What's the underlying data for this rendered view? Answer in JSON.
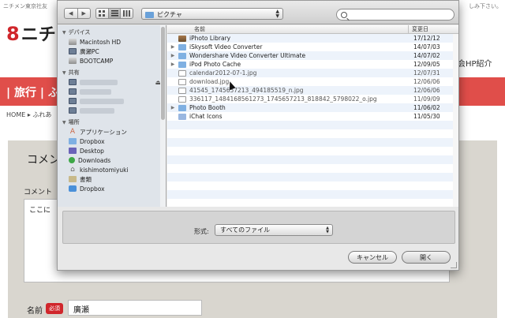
{
  "background": {
    "top_left": "ニチメン東京社友",
    "top_right": "しみ下さい。",
    "logo_text": "ニチ",
    "hp_link": "会HP紹介",
    "nav_text": "| 旅行 | ふ",
    "breadcrumb": "HOME ▸ ふれあ",
    "comment_title": "コメン",
    "comment_label": "コメント",
    "comment_text": "ここに",
    "name_label": "名前",
    "required_badge": "必須",
    "name_value": "廣瀬"
  },
  "dialog": {
    "toolbar": {
      "back": "◀",
      "forward": "▶",
      "location": "ピクチャ",
      "search_value": ""
    },
    "sidebar": {
      "devices_header": "デバイス",
      "devices": [
        {
          "label": "Macintosh HD",
          "icon": "hard-drive-icon"
        },
        {
          "label": "廣瀬PC",
          "icon": "pc-icon"
        },
        {
          "label": "BOOTCAMP",
          "icon": "hard-drive-icon"
        }
      ],
      "shared_header": "共有",
      "places_header": "場所",
      "places": [
        {
          "label": "アプリケーション",
          "icon": "applications-icon"
        },
        {
          "label": "Dropbox",
          "icon": "folder-icon"
        },
        {
          "label": "Desktop",
          "icon": "desktop-icon"
        },
        {
          "label": "Downloads",
          "icon": "downloads-icon"
        },
        {
          "label": "kishimotomiyuki",
          "icon": "home-icon"
        },
        {
          "label": "書類",
          "icon": "documents-icon"
        },
        {
          "label": "Dropbox",
          "icon": "dropbox-icon"
        }
      ]
    },
    "filelist": {
      "col_name": "名前",
      "col_date": "変更日",
      "rows": [
        {
          "name": "iPhoto Library",
          "date": "17/12/12",
          "icon": "photo-library-icon",
          "folder": false
        },
        {
          "name": "iSkysoft Video Converter",
          "date": "14/07/03",
          "icon": "folder-icon",
          "folder": true
        },
        {
          "name": "Wondershare Video Converter Ultimate",
          "date": "14/07/02",
          "icon": "folder-icon",
          "folder": true
        },
        {
          "name": "iPod Photo Cache",
          "date": "12/09/05",
          "icon": "folder-icon",
          "folder": true
        },
        {
          "name": "calendar2012-07-1.jpg",
          "date": "12/07/31",
          "icon": "image-file-icon",
          "folder": false
        },
        {
          "name": "download.jpg",
          "date": "12/06/06",
          "icon": "image-file-icon",
          "folder": false
        },
        {
          "name": "41545_1745657213_494185519_n.jpg",
          "date": "12/06/06",
          "icon": "image-file-icon",
          "folder": false
        },
        {
          "name": "336117_1484168561273_1745657213_818842_5798022_o.jpg",
          "date": "11/09/09",
          "icon": "image-file-icon",
          "folder": false
        },
        {
          "name": "Photo Booth",
          "date": "11/06/02",
          "icon": "folder-icon",
          "folder": true
        },
        {
          "name": "iChat Icons",
          "date": "11/05/30",
          "icon": "folder-icon",
          "folder": true
        }
      ]
    },
    "format": {
      "label": "形式:",
      "selected": "すべてのファイル"
    },
    "buttons": {
      "cancel": "キャンセル",
      "open": "開く"
    }
  }
}
